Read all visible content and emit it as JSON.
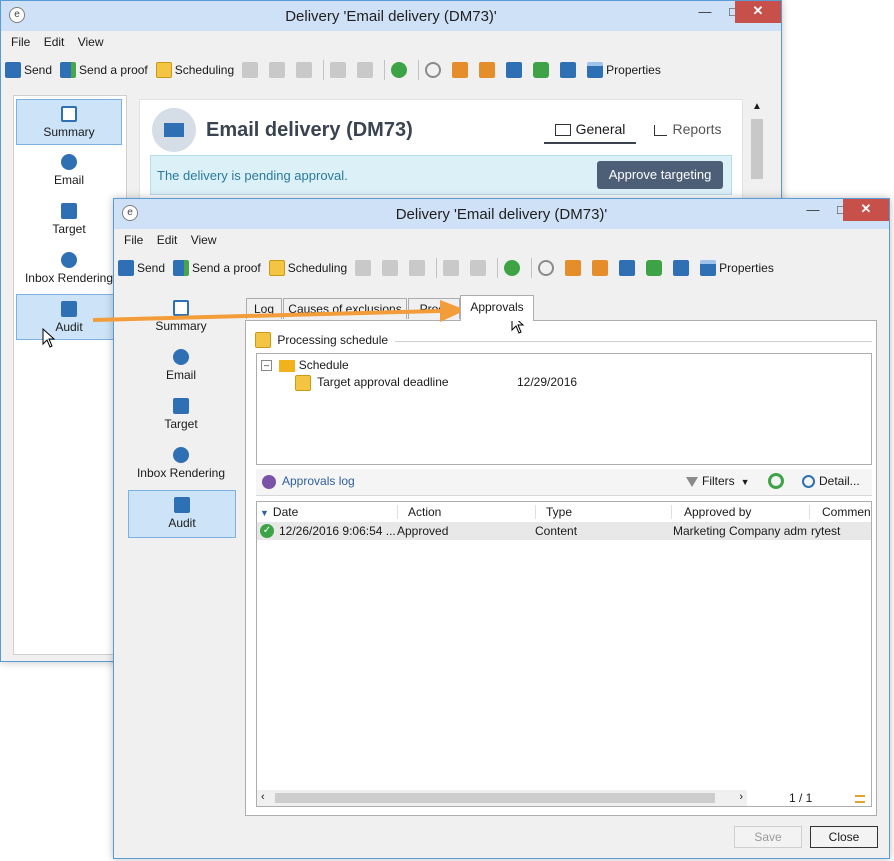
{
  "back_window": {
    "title": "Delivery 'Email delivery (DM73)'",
    "menu": [
      "File",
      "Edit",
      "View"
    ],
    "toolbar": {
      "send": "Send",
      "send_proof": "Send a proof",
      "scheduling": "Scheduling",
      "properties": "Properties"
    },
    "sidebar": [
      "Summary",
      "Email",
      "Target",
      "Inbox Rendering",
      "Audit"
    ],
    "header_title": "Email delivery (DM73)",
    "tabs": {
      "general": "General",
      "reports": "Reports"
    },
    "banner_text": "The delivery is pending approval.",
    "approve_button": "Approve targeting"
  },
  "front_window": {
    "title": "Delivery 'Email delivery (DM73)'",
    "menu": [
      "File",
      "Edit",
      "View"
    ],
    "toolbar": {
      "send": "Send",
      "send_proof": "Send a proof",
      "scheduling": "Scheduling",
      "properties": "Properties"
    },
    "sidebar": [
      "Summary",
      "Email",
      "Target",
      "Inbox Rendering",
      "Audit"
    ],
    "tabs": [
      "Log",
      "Causes of exclusions",
      "Proof",
      "Approvals"
    ],
    "processing_schedule_label": "Processing schedule",
    "tree": {
      "root": "Schedule",
      "child": "Target approval deadline",
      "child_value": "12/29/2016"
    },
    "approvals_log": "Approvals log",
    "filters": "Filters",
    "detail": "Detail...",
    "columns": [
      "Date",
      "Action",
      "Type",
      "Approved by",
      "Commen"
    ],
    "rows": [
      [
        "12/26/2016 9:06:54 ...",
        "Approved",
        "Content",
        "Marketing Company adm",
        "rytest"
      ]
    ],
    "pager": "1 / 1",
    "save": "Save",
    "close": "Close"
  },
  "colors": {
    "accent": "#2f6fb3",
    "arrow": "#f39c3a",
    "selected": "#cde3f8",
    "banner": "#dcf0f7",
    "approve_btn": "#4c5f76"
  }
}
